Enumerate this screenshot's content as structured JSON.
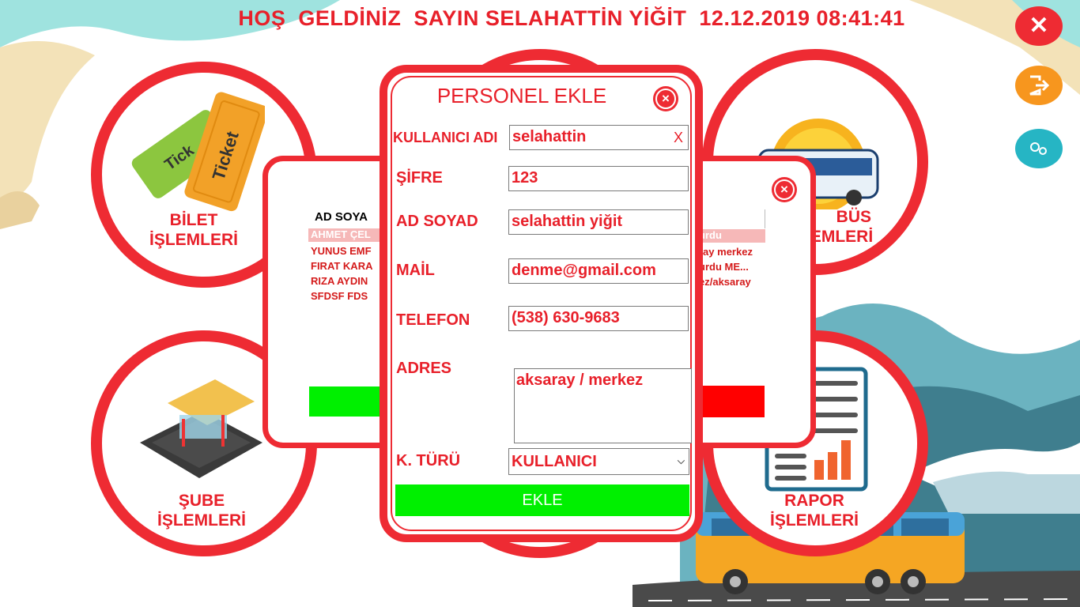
{
  "header": {
    "title": "HOŞ  GELDİNİZ  SAYIN SELAHATTİN YİĞİT  12.12.2019 08:41:41"
  },
  "side_buttons": {
    "close_icon": "close-icon",
    "logout_icon": "logout-icon",
    "settings_icon": "gears-icon",
    "close_color": "#ee2b33",
    "logout_color": "#f7961e",
    "settings_color": "#26b5c4"
  },
  "menu": {
    "ticket_label": "BİLET\nİŞLEMLERİ",
    "ticket_image_word": "Ticket",
    "bus_label": "BÜS\nLEMLERİ",
    "branch_label": "ŞUBE\nİŞLEMLERİ",
    "report_label": "RAPOR\nİŞLEMLERİ"
  },
  "personnel_panel": {
    "header": "AD SOYA",
    "rows": [
      "AHMET ÇEL",
      "YUNUS EMF",
      "FIRAT KARA",
      "RIZA AYDIN",
      "SFDSF FDS"
    ]
  },
  "branch_panel": {
    "rows": [
      "urdu",
      "ray merkez",
      "urdu ME...",
      "ez/aksaray"
    ]
  },
  "dialog": {
    "title": "PERSONEL EKLE",
    "username_label": "KULLANICI ADI",
    "username_value": "selahattin",
    "username_clear": "X",
    "password_label": "ŞİFRE",
    "password_value": "123",
    "fullname_label": "AD SOYAD",
    "fullname_value": "selahattin yiğit",
    "mail_label": "MAİL",
    "mail_value": "denme@gmail.com",
    "phone_label": "TELEFON",
    "phone_value": "(538) 630-9683",
    "address_label": "ADRES",
    "address_value": "aksaray / merkez",
    "type_label": "K. TÜRÜ",
    "type_value": "KULLANICI",
    "add_button": "EKLE"
  },
  "colors": {
    "accent": "#ee2b33",
    "button_green": "#00f000",
    "button_red": "#ff0000"
  }
}
